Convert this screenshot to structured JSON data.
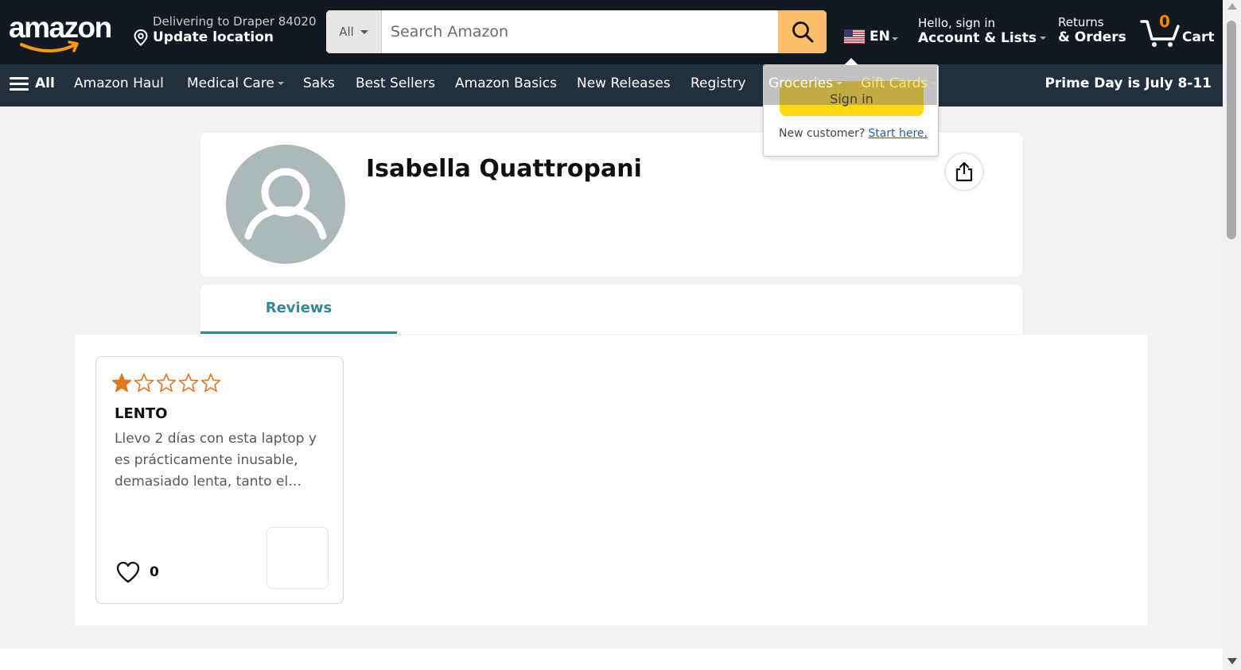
{
  "header": {
    "logo_text": "amazon",
    "deliver_line1": "Delivering to Draper 84020",
    "deliver_line2": "Update location",
    "search_category": "All",
    "search_placeholder": "Search Amazon",
    "language": "EN",
    "account_line1": "Hello, sign in",
    "account_line2": "Account & Lists",
    "returns_line1": "Returns",
    "returns_line2": "& Orders",
    "cart_count": "0",
    "cart_label": "Cart"
  },
  "nav": {
    "all_label": "All",
    "items": [
      "Amazon Haul",
      "Medical Care",
      "Saks",
      "Best Sellers",
      "Amazon Basics",
      "New Releases",
      "Registry",
      "Groceries",
      "Gift Cards"
    ],
    "promo": "Prime Day is July 8-11"
  },
  "signin_popover": {
    "button_label": "Sign in",
    "new_customer_text": "New customer?",
    "start_link": "Start here."
  },
  "profile": {
    "name": "Isabella Quattropani"
  },
  "tabs": {
    "active": "Reviews"
  },
  "review": {
    "rating": 1,
    "max_rating": 5,
    "title": "LENTO",
    "body": "Llevo 2 días con esta laptop y es prácticamente inusable, demasiado lenta, tanto el…",
    "helpful_count": "0"
  },
  "colors": {
    "nav_dark": "#131921",
    "nav_secondary": "#232f3e",
    "search_button": "#febd69",
    "star": "#de7921",
    "tab_accent": "#2c8a99",
    "signin_button": "#ffd814",
    "cart_count": "#f08804"
  }
}
